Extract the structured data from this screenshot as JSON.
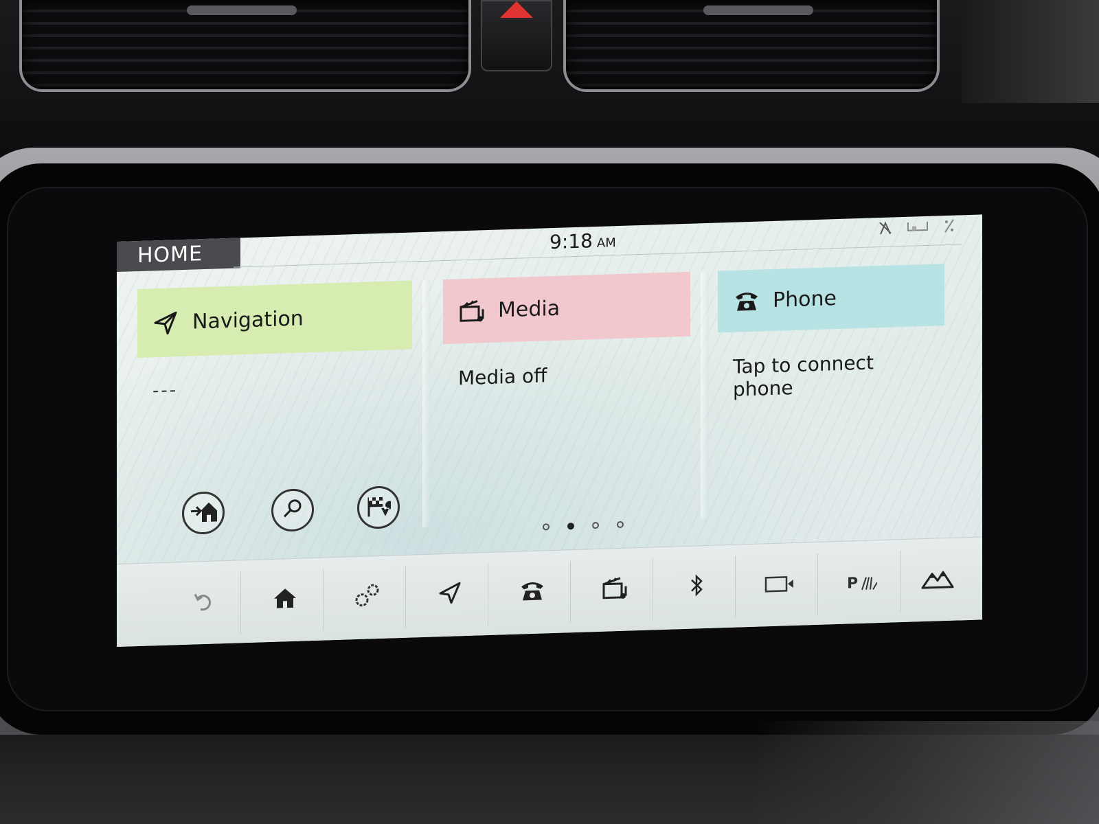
{
  "header": {
    "tab_label": "HOME",
    "time": "9:18",
    "ampm": "AM"
  },
  "status_icons": [
    "antenna-off-icon",
    "battery-icon",
    "percent-icon"
  ],
  "columns": {
    "navigation": {
      "title": "Navigation",
      "status": "---",
      "color": "#d6ecb0",
      "buttons": [
        "navigate-home-icon",
        "search-icon",
        "destination-flag-icon"
      ]
    },
    "media": {
      "title": "Media",
      "status": "Media off",
      "color": "#f0c8ce"
    },
    "phone": {
      "title": "Phone",
      "status": "Tap to connect phone",
      "color": "#b8e3e4"
    }
  },
  "page_indicator": {
    "total": 4,
    "active": 1
  },
  "bottom_bar": {
    "items": [
      "back-icon",
      "home-icon",
      "settings-icon",
      "navigation-icon",
      "phone-icon",
      "media-icon",
      "bluetooth-icon",
      "camera-icon",
      "parking-icon",
      "terrain-icon"
    ],
    "parking_label": "P"
  }
}
